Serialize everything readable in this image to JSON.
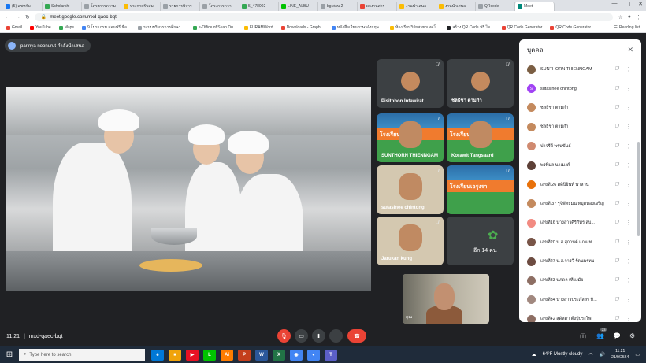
{
  "browser": {
    "tabs": [
      {
        "label": "(5) แชทกับ",
        "color": "#1877f2"
      },
      {
        "label": "Scholarshi",
        "color": "#34a853"
      },
      {
        "label": "โครงการความ",
        "color": "#9aa0a6"
      },
      {
        "label": "ประกาศรับสม",
        "color": "#fbbc04"
      },
      {
        "label": "รายการพิจาร",
        "color": "#9aa0a6"
      },
      {
        "label": "โครงการควา",
        "color": "#9aa0a6"
      },
      {
        "label": "5_478002",
        "color": "#34a853"
      },
      {
        "label": "LINE_ALBU",
        "color": "#00c300"
      },
      {
        "label": "bg สอบ 2",
        "color": "#9aa0a6"
      },
      {
        "label": "ผลงานสาร",
        "color": "#ea4335"
      },
      {
        "label": "งานนำเสนอ",
        "color": "#fbbc04"
      },
      {
        "label": "งานนำเสนอ",
        "color": "#fbbc04"
      },
      {
        "label": "QRcode",
        "color": "#9aa0a6"
      },
      {
        "label": "Meet",
        "color": "#00897b"
      }
    ],
    "url": "meet.google.com/mxd-qaec-bqt",
    "bookmarks": [
      {
        "label": "Gmail",
        "color": "#ea4335"
      },
      {
        "label": "YouTube",
        "color": "#ff0000"
      },
      {
        "label": "Maps",
        "color": "#34a853"
      },
      {
        "label": "9 โปรแกรม สอนฟรีเพื่อ...",
        "color": "#4285f4"
      },
      {
        "label": "ระบบบริหารการศึกษา ...",
        "color": "#9aa0a6"
      },
      {
        "label": "e-Office of Suan Du...",
        "color": "#34a853"
      },
      {
        "label": "FURAMWord",
        "color": "#fbbc04"
      },
      {
        "label": "Downloads - Graph...",
        "color": "#ea4335"
      },
      {
        "label": "หนังสือเรียนภาษาอังกฤษ...",
        "color": "#4285f4"
      },
      {
        "label": "ห้องเรียนวิจัยสาขาเทคโ...",
        "color": "#fbbc04"
      },
      {
        "label": "สร้าง QR Code ฟรี ไม...",
        "color": "#202124"
      },
      {
        "label": "QR Code Generator",
        "color": "#ea4335"
      },
      {
        "label": "QR Code Generator",
        "color": "#ea4335"
      }
    ],
    "reading_list": "Reading list"
  },
  "meet": {
    "presenter_label": "parinya noonurut กำลังนำเสนอ",
    "meeting_code": "mxd-qaec-bqt",
    "time": "11:21",
    "tiles": [
      {
        "name": "Pisitphon Intawirat",
        "kind": "avatar"
      },
      {
        "name": "ชลธิชา ตามกำ",
        "kind": "avatar"
      },
      {
        "name": "SUNTHORN THIENNGAM",
        "kind": "slide",
        "slide_text": "โรงเรียนเอ"
      },
      {
        "name": "Korawit Tangsaard",
        "kind": "slide",
        "slide_text": "โรงเรียนเอ"
      },
      {
        "name": "sutasinee chintong",
        "kind": "face"
      },
      {
        "name": "",
        "kind": "slide",
        "slide_text": "โรงเรียนเอรุงรา"
      },
      {
        "name": "Jarukan kung",
        "kind": "face"
      }
    ],
    "more_count": "อีก 14 คน",
    "self_name": "คุณ",
    "participants_panel": {
      "title": "บุคคล",
      "participants": [
        {
          "name": "SUNTHORN THIENNGAM",
          "color": "#7b5e43"
        },
        {
          "name": "sutasinee chintong",
          "color": "#a142f4",
          "initial": "s"
        },
        {
          "name": "ชลธิชา ตามกำ",
          "color": "#c48a5e"
        },
        {
          "name": "ชลธิชา ตามกำ",
          "color": "#c48a5e"
        },
        {
          "name": "ปาจรีย์ พรุนขันธ์",
          "color": "#d08a70"
        },
        {
          "name": "พรพิมล นาเมงค์",
          "color": "#5d4037"
        },
        {
          "name": "เลขที่ 26 ศศิปิยินท์ นาสวน",
          "color": "#e8710a"
        },
        {
          "name": "เลขที่ 37 รุจีพัทธมน หมุดทองเจริญ",
          "color": "#c48a5e"
        },
        {
          "name": "เลขที่16 นางสาวศิริภัทร สบ...",
          "color": "#f28b82"
        },
        {
          "name": "เลขที่20 น.ส.สุกานต์ แกนเท",
          "color": "#795548"
        },
        {
          "name": "เลขที่27 น.ส.จารวี รัตนพรหม",
          "color": "#6d4c41"
        },
        {
          "name": "เลขที่33 นภดล เที่ยงมัย",
          "color": "#8d6e63"
        },
        {
          "name": "เลขที่34 นางสาวประภัสสร ทิ...",
          "color": "#a1887f"
        },
        {
          "name": "เลขที่42 สุดัลดา ตั้งปุ่ประโพ",
          "color": "#8d6e63"
        }
      ]
    },
    "people_badge": "23"
  },
  "taskbar": {
    "search_placeholder": "Type here to search",
    "weather": "64°F  Mostly cloudy",
    "clock_time": "11:21",
    "clock_date": "21/9/2564",
    "apps": [
      {
        "label": "e",
        "color": "#0078d7"
      },
      {
        "label": "■",
        "color": "#f0a30a"
      },
      {
        "label": "▶",
        "color": "#e81123"
      },
      {
        "label": "L",
        "color": "#00c300"
      },
      {
        "label": "Ai",
        "color": "#ff7c00"
      },
      {
        "label": "P",
        "color": "#c43e1c"
      },
      {
        "label": "W",
        "color": "#2b579a"
      },
      {
        "label": "X",
        "color": "#217346"
      },
      {
        "label": "◉",
        "color": "#4285f4"
      },
      {
        "label": "◐",
        "color": "#4285f4"
      },
      {
        "label": "T",
        "color": "#5b5fc7"
      }
    ]
  }
}
